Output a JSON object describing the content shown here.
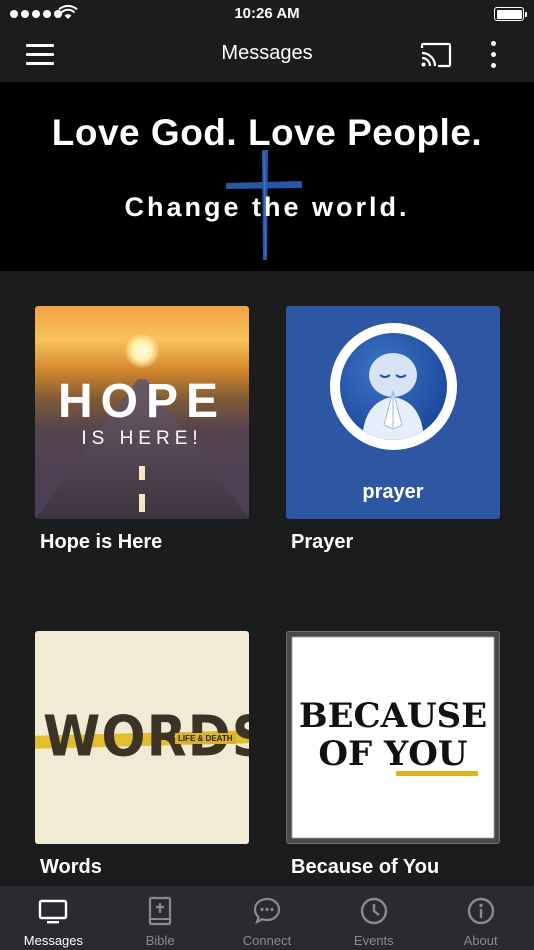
{
  "status_bar": {
    "time": "10:26 AM"
  },
  "app_bar": {
    "title": "Messages"
  },
  "banner": {
    "line1": "Love God. Love People.",
    "line2": "Change the world."
  },
  "series": [
    {
      "title": "Hope is Here",
      "art_main": "HOPE",
      "art_sub": "IS HERE!"
    },
    {
      "title": "Prayer",
      "art_word": "prayer"
    },
    {
      "title": "Words",
      "art_main": "WORDS",
      "art_badge": "LIFE & DEATH"
    },
    {
      "title": "Because of You",
      "art_line1": "BECAUSE",
      "art_line2": "OF YOU"
    }
  ],
  "tabs": [
    {
      "label": "Messages",
      "icon": "tv-icon",
      "active": true
    },
    {
      "label": "Bible",
      "icon": "bible-icon",
      "active": false
    },
    {
      "label": "Connect",
      "icon": "chat-icon",
      "active": false
    },
    {
      "label": "Events",
      "icon": "clock-icon",
      "active": false
    },
    {
      "label": "About",
      "icon": "info-icon",
      "active": false
    }
  ],
  "colors": {
    "background": "#1b1c1e",
    "tab_bar": "#2a2b2e",
    "tab_inactive": "#8a8b8e",
    "prayer_blue": "#2e57a3",
    "cross_blue": "#2d5fb8"
  }
}
